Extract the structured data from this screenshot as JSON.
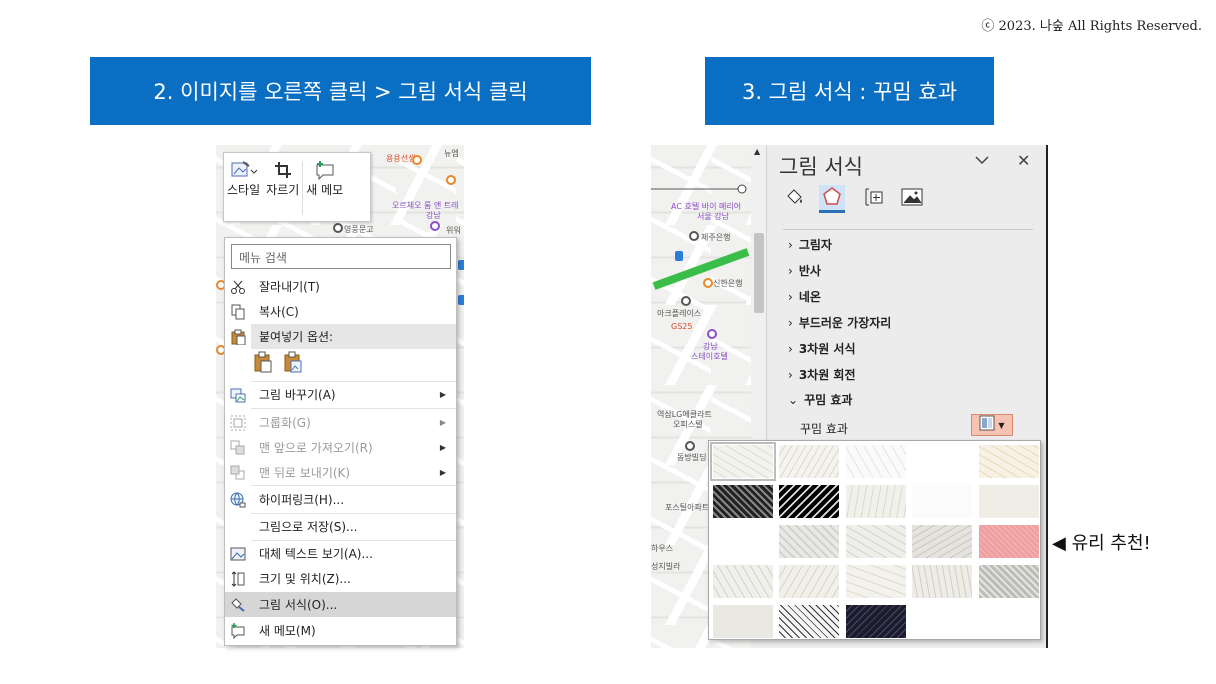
{
  "copyright": "ⓒ 2023. 나숲 All Rights Reserved.",
  "steps": {
    "step2": "2. 이미지를 오른쪽 클릭  > 그림 서식 클릭",
    "step3": "3. 그림 서식 : 꾸밈 효과"
  },
  "map_left_labels": [
    "용용선생",
    "뉴엠",
    "오르체오 룸 앤 트레",
    "강남",
    "영풍문고",
    "위워"
  ],
  "map_right_labels": [
    "AC 호텔 바이 메리어",
    "서울 강남",
    "제주은행",
    "신한은행",
    "아크플레이스",
    "GS25",
    "강남",
    "스테이호텔",
    "역삼LG에클라트",
    "오피스텔",
    "동방빌딩",
    "포스틸아파트",
    "하우스",
    "성지빌라"
  ],
  "mini_toolbar": {
    "style": "스타일",
    "crop": "자르기",
    "new_memo": "새 메모"
  },
  "context_menu": {
    "search_placeholder": "메뉴 검색",
    "items": [
      {
        "label": "잘라내기(T)"
      },
      {
        "label": "복사(C)"
      },
      {
        "label": "붙여넣기 옵션:"
      },
      {
        "label": "그림 바꾸기(A)"
      },
      {
        "label": "그룹화(G)"
      },
      {
        "label": "맨 앞으로 가져오기(R)"
      },
      {
        "label": "맨 뒤로 보내기(K)"
      },
      {
        "label": "하이퍼링크(H)..."
      },
      {
        "label": "그림으로 저장(S)..."
      },
      {
        "label": "대체 텍스트 보기(A)..."
      },
      {
        "label": "크기 및 위치(Z)..."
      },
      {
        "label": "그림 서식(O)..."
      },
      {
        "label": "새 메모(M)"
      }
    ]
  },
  "format_pane": {
    "title": "그림 서식",
    "sections": [
      "그림자",
      "반사",
      "네온",
      "부드러운 가장자리",
      "3차원 서식",
      "3차원 회전",
      "꾸밈 효과"
    ],
    "effect_label": "꾸밈 효과"
  },
  "callout": "◀ 유리 추천!",
  "colors": {
    "banner": "#0a6fc2",
    "highlight_tab": "#cfe2f7",
    "effect_button": "#f6c3b3",
    "glass_effect": "#ef9f9f"
  }
}
